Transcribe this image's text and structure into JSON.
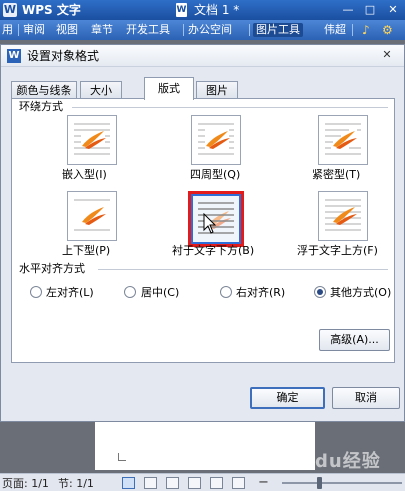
{
  "app": {
    "logo": "W",
    "name": "WPS 文字",
    "doc_icon": "W",
    "doc_title": "文档 1 *",
    "minimize": "—",
    "maximize": "□",
    "close": "✕"
  },
  "menu": {
    "items": [
      "用",
      "审阅",
      "视图",
      "章节",
      "开发工具",
      "办公空间",
      "图片工具",
      "伟超"
    ],
    "active_item": "图片工具",
    "user_icon": "♪",
    "extra_icon": "⚙"
  },
  "dialog": {
    "logo": "W",
    "title": "设置对象格式",
    "close": "✕",
    "tabs": [
      "颜色与线条",
      "大小",
      "版式",
      "图片"
    ],
    "active_tab": "版式",
    "wrap_group_label": "环绕方式",
    "wrap_options": [
      {
        "label": "嵌入型(I)",
        "icon": "inline-wrap-icon"
      },
      {
        "label": "四周型(Q)",
        "icon": "square-wrap-icon"
      },
      {
        "label": "紧密型(T)",
        "icon": "tight-wrap-icon"
      },
      {
        "label": "上下型(P)",
        "icon": "top-bottom-wrap-icon"
      },
      {
        "label": "衬于文字下方(B)",
        "icon": "behind-text-icon"
      },
      {
        "label": "浮于文字上方(F)",
        "icon": "in-front-of-text-icon"
      }
    ],
    "selected_wrap": "衬于文字下方(B)",
    "align_group_label": "水平对齐方式",
    "align_options": [
      "左对齐(L)",
      "居中(C)",
      "右对齐(R)",
      "其他方式(O)"
    ],
    "selected_align": "其他方式(O)",
    "advanced_button": "高级(A)...",
    "ok_button": "确定",
    "cancel_button": "取消"
  },
  "status": {
    "page": "页面: 1/1",
    "section": "节: 1/1",
    "zoom_minus": "−",
    "zoom_plus": "+"
  },
  "watermark": "Baidu经验",
  "colors": {
    "selection_border": "#e31b1b",
    "title_bar": "#2f6fc8",
    "dialog_bg": "#e4e9f1"
  }
}
